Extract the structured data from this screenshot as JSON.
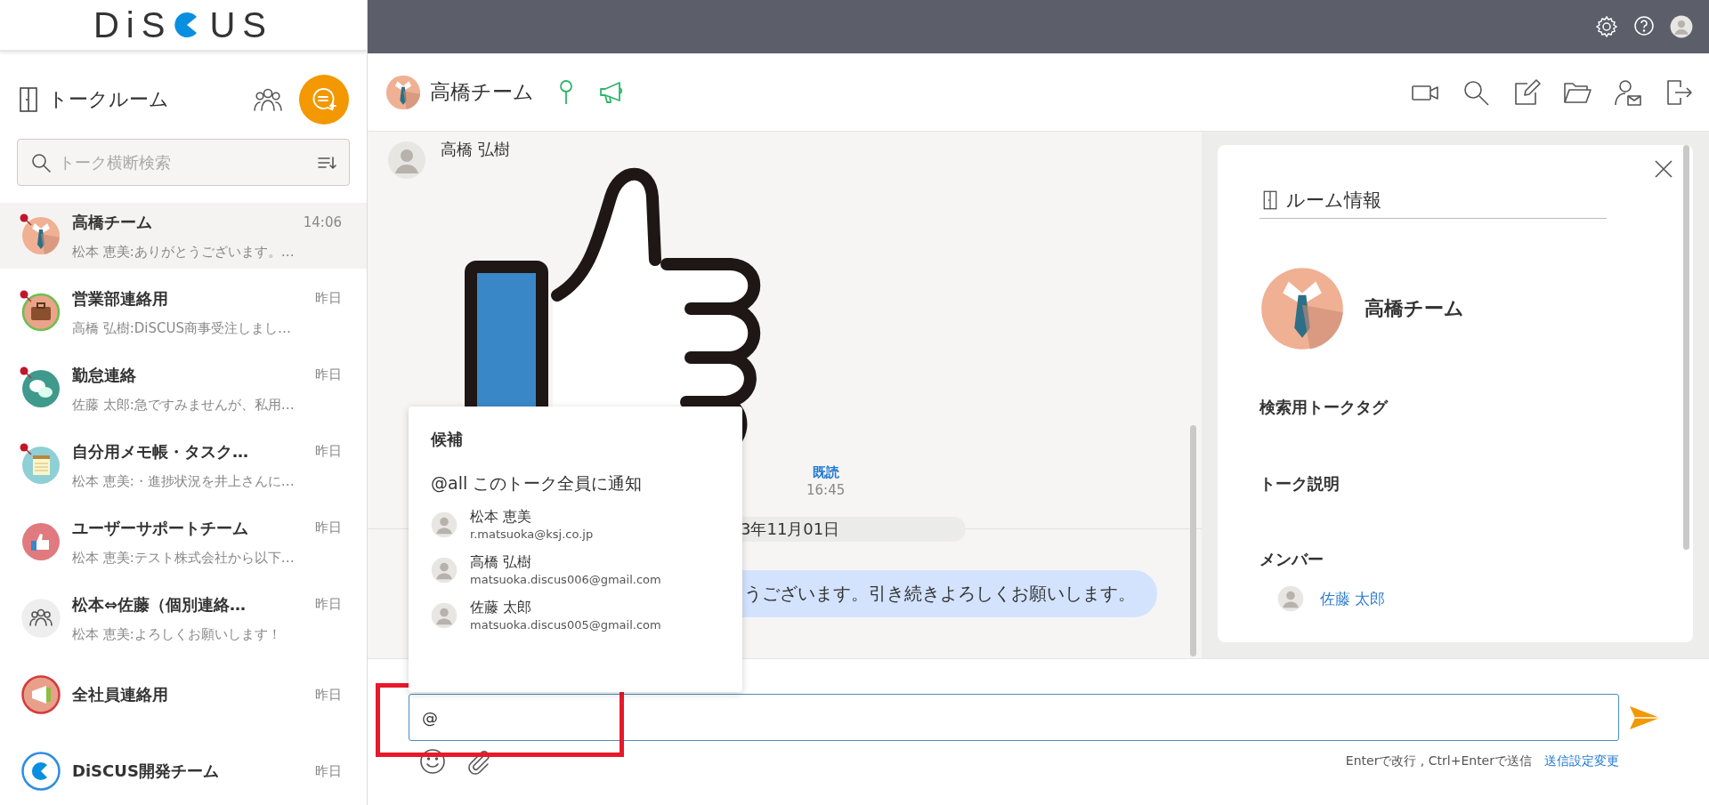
{
  "logo": {
    "text_before": "DiS",
    "text_after": "US"
  },
  "sidebar": {
    "title": "トークルーム",
    "search": {
      "placeholder": "トーク横断検索"
    },
    "rooms": [
      {
        "name": "高橋チーム",
        "time": "14:06",
        "preview": "松本 恵美:ありがとうございます。…",
        "pinned": true,
        "selected": true,
        "kind": "tie",
        "color": "#f0b093"
      },
      {
        "name": "営業部連絡用",
        "time": "昨日",
        "preview": "高橋 弘樹:DiSCUS商事受注しまし…",
        "pinned": true,
        "selected": false,
        "kind": "briefcase",
        "color": "#e9a48a"
      },
      {
        "name": "勤怠連絡",
        "time": "昨日",
        "preview": "佐藤 太郎:急ですみませんが、私用…",
        "pinned": true,
        "selected": false,
        "kind": "chat",
        "color": "#3f9a8c"
      },
      {
        "name": "自分用メモ帳・タスク…",
        "time": "昨日",
        "preview": "松本 恵美:・進捗状況を井上さんに…",
        "pinned": true,
        "selected": false,
        "kind": "memo",
        "color": "#8fcfd6"
      },
      {
        "name": "ユーザーサポートチーム",
        "time": "昨日",
        "preview": "松本 恵美:テスト株式会社から以下…",
        "pinned": false,
        "selected": false,
        "kind": "thumb",
        "color": "#e07a7f"
      },
      {
        "name": "松本⇔佐藤（個別連絡…",
        "time": "昨日",
        "preview": "松本 恵美:よろしくお願いします！",
        "pinned": false,
        "selected": false,
        "kind": "group",
        "color": "#eeeeee"
      },
      {
        "name": "全社員連絡用",
        "time": "昨日",
        "pinned": false,
        "selected": false,
        "kind": "megaphone",
        "color": "#e8a08a"
      },
      {
        "name": "DiSCUS開発チーム",
        "time": "昨日",
        "pinned": false,
        "selected": false,
        "kind": "logo",
        "color": "#2f8de0"
      }
    ]
  },
  "chat": {
    "title": "高橋チーム",
    "sender": "高橋 弘樹",
    "read_label": "既読",
    "time": "16:45",
    "date": "3年11月01日",
    "bubble": "うございます。引き続きよろしくお願いします。"
  },
  "mention_popup": {
    "title": "候補",
    "all_option": "@all このトーク全員に通知",
    "candidates": [
      {
        "name": "松本 恵美",
        "email": "r.matsuoka@ksj.co.jp"
      },
      {
        "name": "高橋 弘樹",
        "email": "matsuoka.discus006@gmail.com"
      },
      {
        "name": "佐藤 太郎",
        "email": "matsuoka.discus005@gmail.com"
      }
    ]
  },
  "composer": {
    "value": "@",
    "highlight": true,
    "hint": "Enterで改行 , Ctrl+Enterで送信",
    "settings_link": "送信設定変更"
  },
  "room_info": {
    "title": "ルーム情報",
    "room_name": "高橋チーム",
    "tag_heading": "検索用トークタグ",
    "description_heading": "トーク説明",
    "members_heading": "メンバー",
    "members": [
      "佐藤 太郎"
    ]
  }
}
